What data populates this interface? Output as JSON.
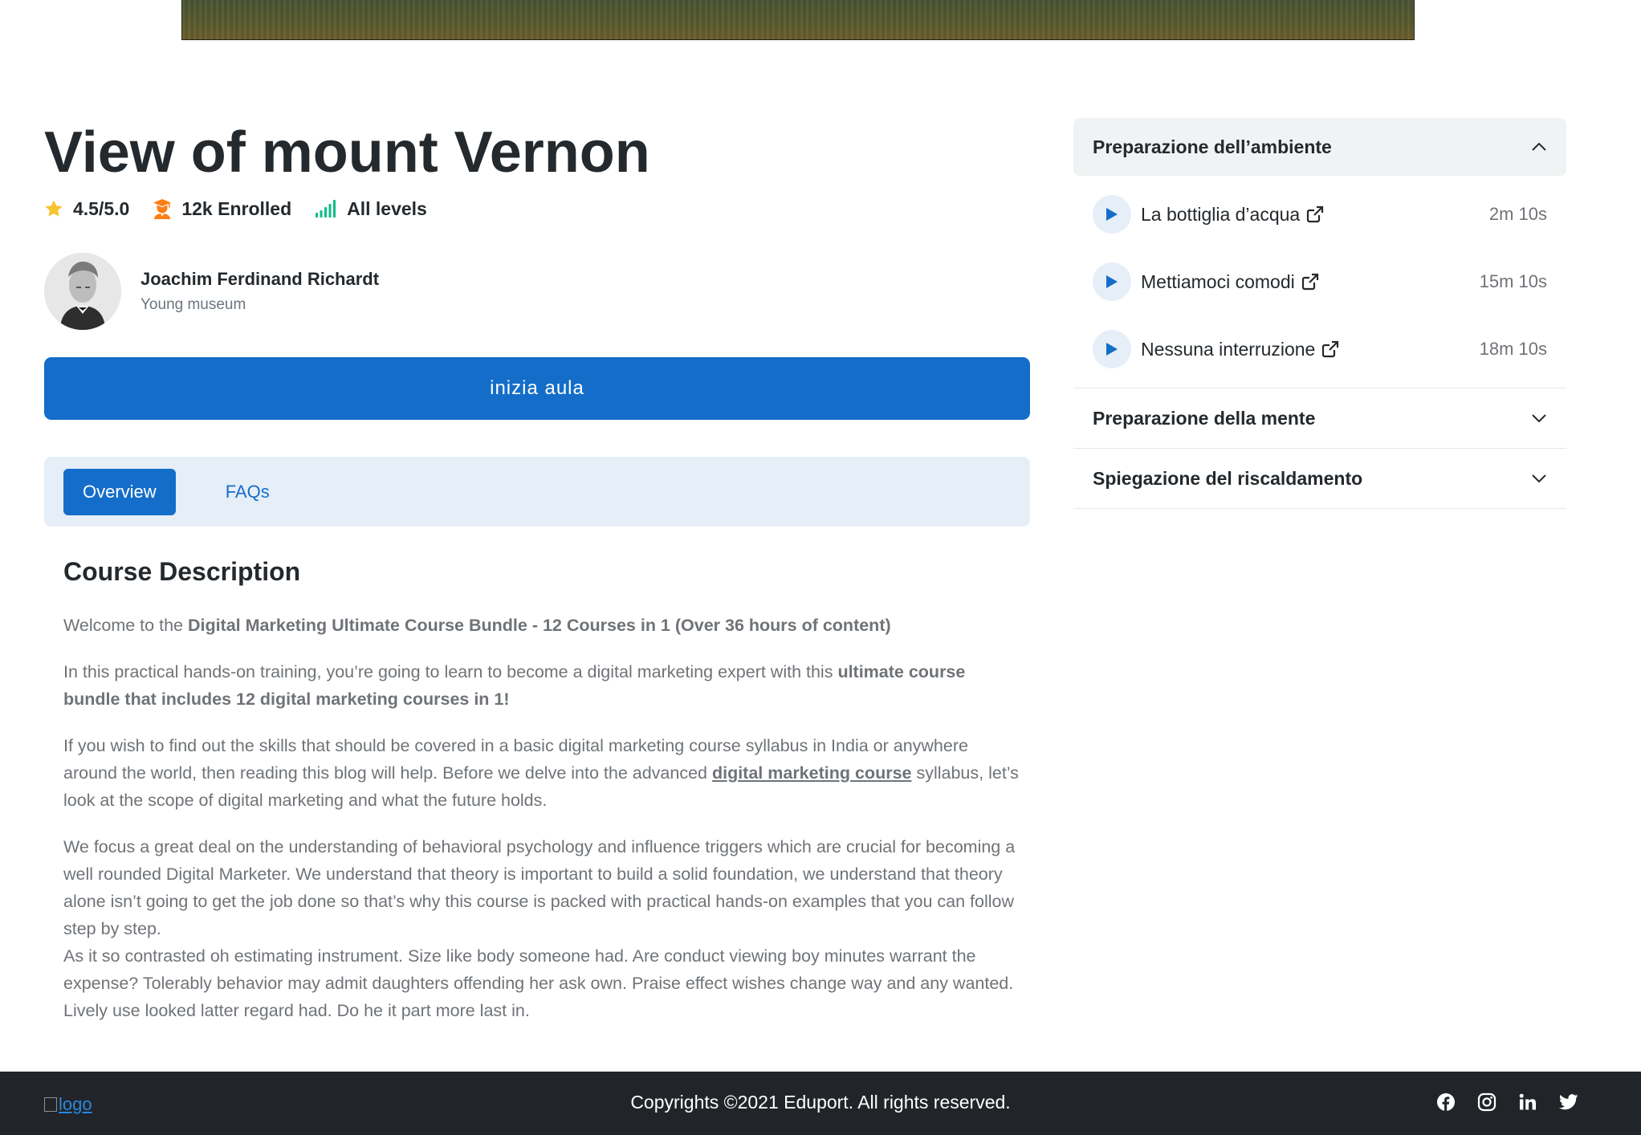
{
  "course": {
    "title": "View of mount Vernon",
    "rating": "4.5/5.0",
    "enrolled": "12k Enrolled",
    "level": "All levels"
  },
  "instructor": {
    "name": "Joachim Ferdinand Richardt",
    "organization": "Young museum"
  },
  "start_button": "inizia aula",
  "tabs": [
    {
      "label": "Overview",
      "active": true
    },
    {
      "label": "FAQs",
      "active": false
    }
  ],
  "description": {
    "heading": "Course Description",
    "p1_prefix": "Welcome to the ",
    "p1_bold": "Digital Marketing Ultimate Course Bundle - 12 Courses in 1 (Over 36 hours of content)",
    "p2_text": "In this practical hands-on training, you’re going to learn to become a digital marketing expert with this ",
    "p2_bold": "ultimate course bundle that includes 12 digital marketing courses in 1!",
    "p3_before": "If you wish to find out the skills that should be covered in a basic digital marketing course syllabus in India or anywhere around the world, then reading this blog will help. Before we delve into the advanced ",
    "p3_link": "digital marketing course",
    "p3_after": " syllabus, let’s look at the scope of digital marketing and what the future holds.",
    "p4": "We focus a great deal on the understanding of behavioral psychology and influence triggers which are crucial for becoming a well rounded Digital Marketer. We understand that theory is important to build a solid foundation, we understand that theory alone isn’t going to get the job done so that’s why this course is packed with practical hands-on examples that you can follow step by step.",
    "p5": "As it so contrasted oh estimating instrument. Size like body someone had. Are conduct viewing boy minutes warrant the expense? Tolerably behavior may admit daughters offending her ask own. Praise effect wishes change way and any wanted. Lively use looked latter regard had. Do he it part more last in."
  },
  "curriculum": {
    "sections": [
      {
        "title": "Preparazione dell’ambiente",
        "expanded": true,
        "lessons": [
          {
            "label": "La bottiglia d’acqua",
            "duration": "2m 10s"
          },
          {
            "label": "Mettiamoci comodi",
            "duration": "15m 10s"
          },
          {
            "label": "Nessuna interruzione",
            "duration": "18m 10s"
          }
        ]
      },
      {
        "title": "Preparazione della mente",
        "expanded": false
      },
      {
        "title": "Spiegazione del riscaldamento",
        "expanded": false
      }
    ]
  },
  "footer": {
    "logo_alt": "logo",
    "copyright": "Copyrights ©2021 Eduport. All rights reserved.",
    "social_icons": [
      "facebook-icon",
      "instagram-icon",
      "linkedin-icon",
      "twitter-icon"
    ]
  },
  "colors": {
    "primary": "#146ec9",
    "primary_light": "#e6eef8",
    "text_dark": "#24292d",
    "text_muted": "#6f7377",
    "footer_bg": "#212529",
    "star": "#f7c32e",
    "enrolled_icon": "#fd7e14",
    "level_icon": "#0cbc87"
  }
}
